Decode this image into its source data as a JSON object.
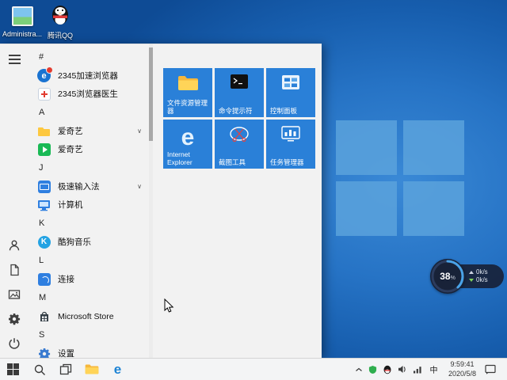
{
  "desktop": {
    "icons": [
      {
        "label": "Administra..."
      },
      {
        "label": "腾讯QQ"
      }
    ]
  },
  "start": {
    "list": [
      {
        "kind": "header",
        "label": "#"
      },
      {
        "kind": "app",
        "label": "2345加速浏览器"
      },
      {
        "kind": "app",
        "label": "2345浏览器医生"
      },
      {
        "kind": "header",
        "label": "A"
      },
      {
        "kind": "app",
        "label": "爱奇艺",
        "expand": "∨"
      },
      {
        "kind": "app",
        "label": "爱奇艺"
      },
      {
        "kind": "header",
        "label": "J"
      },
      {
        "kind": "app",
        "label": "极速输入法",
        "expand": "∨"
      },
      {
        "kind": "app",
        "label": "计算机"
      },
      {
        "kind": "header",
        "label": "K"
      },
      {
        "kind": "app",
        "label": "酷狗音乐"
      },
      {
        "kind": "header",
        "label": "L"
      },
      {
        "kind": "app",
        "label": "连接"
      },
      {
        "kind": "header",
        "label": "M"
      },
      {
        "kind": "app",
        "label": "Microsoft Store"
      },
      {
        "kind": "header",
        "label": "S"
      },
      {
        "kind": "app",
        "label": "设置"
      }
    ],
    "tiles": [
      {
        "label": "文件资源管理器"
      },
      {
        "label": "命令提示符"
      },
      {
        "label": "控制面板"
      },
      {
        "label": "Internet Explorer"
      },
      {
        "label": "截图工具"
      },
      {
        "label": "任务管理器"
      }
    ]
  },
  "net_widget": {
    "percent": "38",
    "unit": "%",
    "up_speed": "0k/s",
    "down_speed": "0k/s"
  },
  "taskbar": {
    "ime": "中",
    "clock": {
      "time": "9:59:41",
      "date": "2020/5/8"
    }
  },
  "glyphs": {
    "browser_e": "e",
    "ie_e": "e",
    "edge_e": "e",
    "kugou_k": "K"
  },
  "colors": {
    "accent": "#0078d7",
    "tile_blue": "#2a80d8",
    "taskbar_bg": "#f3f4f5",
    "start_bg": "#f2f2f2",
    "wallpaper_logo": "#5aa2dc"
  }
}
